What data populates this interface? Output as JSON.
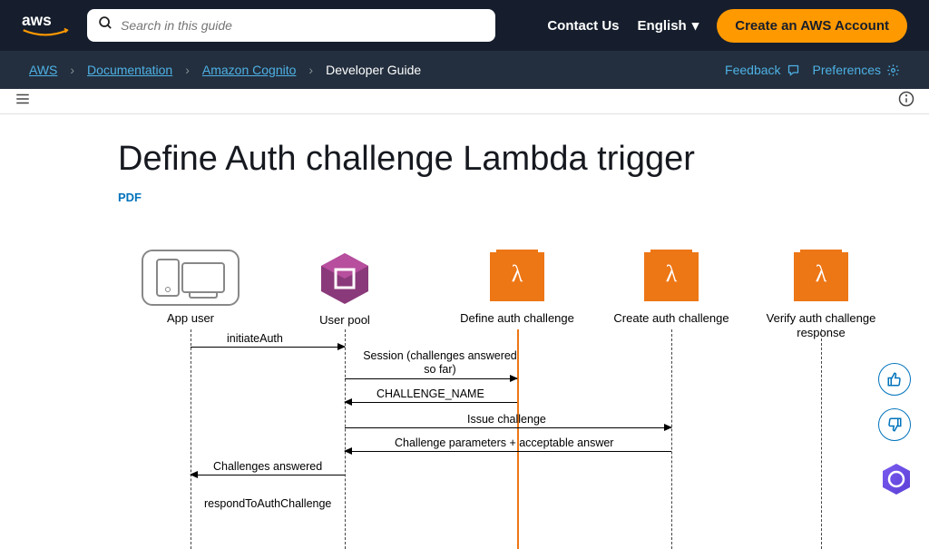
{
  "header": {
    "search_placeholder": "Search in this guide",
    "contact": "Contact Us",
    "language": "English",
    "create_account": "Create an AWS Account"
  },
  "breadcrumb": {
    "aws": "AWS",
    "docs": "Documentation",
    "service": "Amazon Cognito",
    "guide": "Developer Guide",
    "feedback": "Feedback",
    "preferences": "Preferences"
  },
  "page": {
    "title": "Define Auth challenge Lambda trigger",
    "pdf": "PDF"
  },
  "diagram": {
    "actors": {
      "app_user": "App user",
      "user_pool": "User pool",
      "define": "Define auth challenge",
      "create": "Create auth challenge",
      "verify": "Verify auth challenge response"
    },
    "messages": {
      "initiateAuth": "initiateAuth",
      "session": "Session (challenges answered so far)",
      "challenge_name": "CHALLENGE_NAME",
      "issue_challenge": "Issue challenge",
      "challenge_params": "Challenge parameters + acceptable answer",
      "challenges_answered": "Challenges answered",
      "respond": "respondToAuthChallenge"
    }
  }
}
